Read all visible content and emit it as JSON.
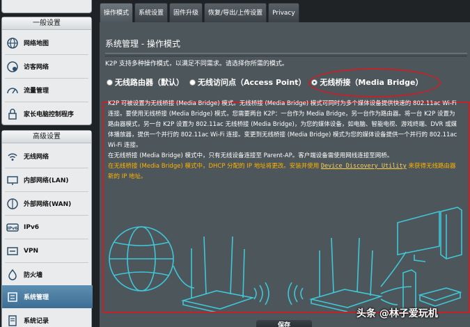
{
  "sidebar": {
    "general": {
      "header": "一般设置",
      "items": [
        {
          "label": "网络地图",
          "icon": "globe-icon"
        },
        {
          "label": "访客网络",
          "icon": "guest-network-icon"
        },
        {
          "label": "流量管理",
          "icon": "gauge-icon"
        },
        {
          "label": "家长电脑控制程序",
          "icon": "parental-lock-icon"
        }
      ]
    },
    "advanced": {
      "header": "高级设置",
      "items": [
        {
          "label": "无线网络",
          "icon": "wifi-icon"
        },
        {
          "label": "内部网络(LAN)",
          "icon": "lan-icon"
        },
        {
          "label": "外部网络(WAN)",
          "icon": "wan-globe-icon"
        },
        {
          "label": "IPv6",
          "icon": "ipv6-icon"
        },
        {
          "label": "VPN",
          "icon": "vpn-icon"
        },
        {
          "label": "防火墙",
          "icon": "firewall-icon"
        },
        {
          "label": "系统管理",
          "icon": "admin-icon"
        },
        {
          "label": "系统记录",
          "icon": "log-icon"
        }
      ]
    }
  },
  "tabs": [
    "操作模式",
    "系统设置",
    "固件升级",
    "恢复/导出/上传设置",
    "Privacy"
  ],
  "active_tab": "操作模式",
  "main": {
    "title": "系统管理 - 操作模式",
    "description": "K2P 支持多种操作模式，以满足不同需求。请选择你所需的模式。",
    "modes": [
      {
        "label": "无线路由器（默认）",
        "checked": false
      },
      {
        "label": "无线访问点（Access Point）",
        "checked": false
      },
      {
        "label": "无线桥接（Media Bridge）",
        "checked": true
      }
    ],
    "paragraph1": "K2P 可被设置为无线桥接 (Media Bridge) 模式。无线桥接 (Media Bridge) 模式可同时为多个媒体设备提供快速的 802.11ac Wi-Fi 连接。要使用无线桥接 (Media Bridge) 模式，您需要两台 K2P：一台作为 Media Bridge，另一台作为路由器。将一台 K2P 设置为路由器模式，另一台 K2P 设置为 802.11ac 无线桥接 (Media Bridge)，为您的媒体设备，如电脑、智能电视、游戏终端、DVR 或媒体播放器，提供一个并行的 802.11ac Wi-Fi 连接。变更到无线桥接 (Media Bridge) 模式为您的媒体设备提供一个并行的 802.11ac Wi-Fi 连接。",
    "paragraph2": "在无线桥接 (Media Bridge) 模式中，只有无线设备连接至 Parent-AP。客户端设备需使用网线连接至网桥。",
    "warning_prefix": "在无线桥接 (Media Bridge) 模式中，DHCP 分配的 IP 地址将更改。安装并使用 ",
    "warning_link": "Device Discovery Utility",
    "warning_suffix": " 来获得无线路由器新的 IP 地址。",
    "save_label": "保存"
  },
  "watermark": "头条 @林子爱玩机",
  "colors": {
    "highlight_red": "#c2222a",
    "warning_orange": "#ffb400",
    "illustration_cyan": "#3fc7d8",
    "panel_bg": "#4d565b",
    "active_menu": "#4a7ca3"
  }
}
